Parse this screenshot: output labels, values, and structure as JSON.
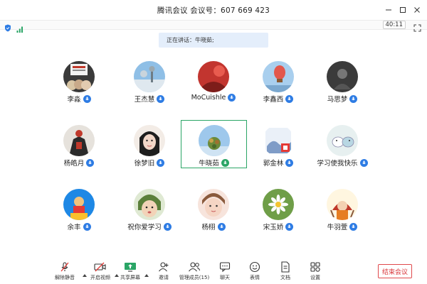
{
  "window": {
    "title": "腾讯会议 会议号：607 669 423"
  },
  "status": {
    "timer": "40:11"
  },
  "speaking": {
    "text": "正在讲话：牛晓茹;"
  },
  "participants": [
    {
      "name": "李淼",
      "mic": "blue"
    },
    {
      "name": "王杰慧",
      "mic": "blue"
    },
    {
      "name": "MoCuishle",
      "mic": "blue"
    },
    {
      "name": "李鑫西",
      "mic": "blue"
    },
    {
      "name": "马思梦",
      "mic": "blue"
    },
    {
      "name": "杨皓月",
      "mic": "blue"
    },
    {
      "name": "徐梦旧",
      "mic": "blue"
    },
    {
      "name": "牛晓茹",
      "mic": "green",
      "active": true
    },
    {
      "name": "郭金林",
      "mic": "blue"
    },
    {
      "name": "学习使我快乐",
      "mic": "blue"
    },
    {
      "name": "余丰",
      "mic": "blue"
    },
    {
      "name": "祝你爱学习",
      "mic": "blue"
    },
    {
      "name": "杨栩",
      "mic": "blue"
    },
    {
      "name": "宋玉娇",
      "mic": "blue"
    },
    {
      "name": "牛羽萱",
      "mic": "blue"
    }
  ],
  "toolbar": {
    "unmute": "解除静音",
    "video": "开启视频",
    "share": "共享屏幕",
    "invite": "邀请",
    "members": "管理成员(15)",
    "chat": "聊天",
    "emoji": "表情",
    "docs": "文档",
    "settings": "设置",
    "end": "结束会议"
  },
  "colors": {
    "accent": "#2e7ce4",
    "speaking": "#2aa566",
    "danger": "#d9363a"
  }
}
